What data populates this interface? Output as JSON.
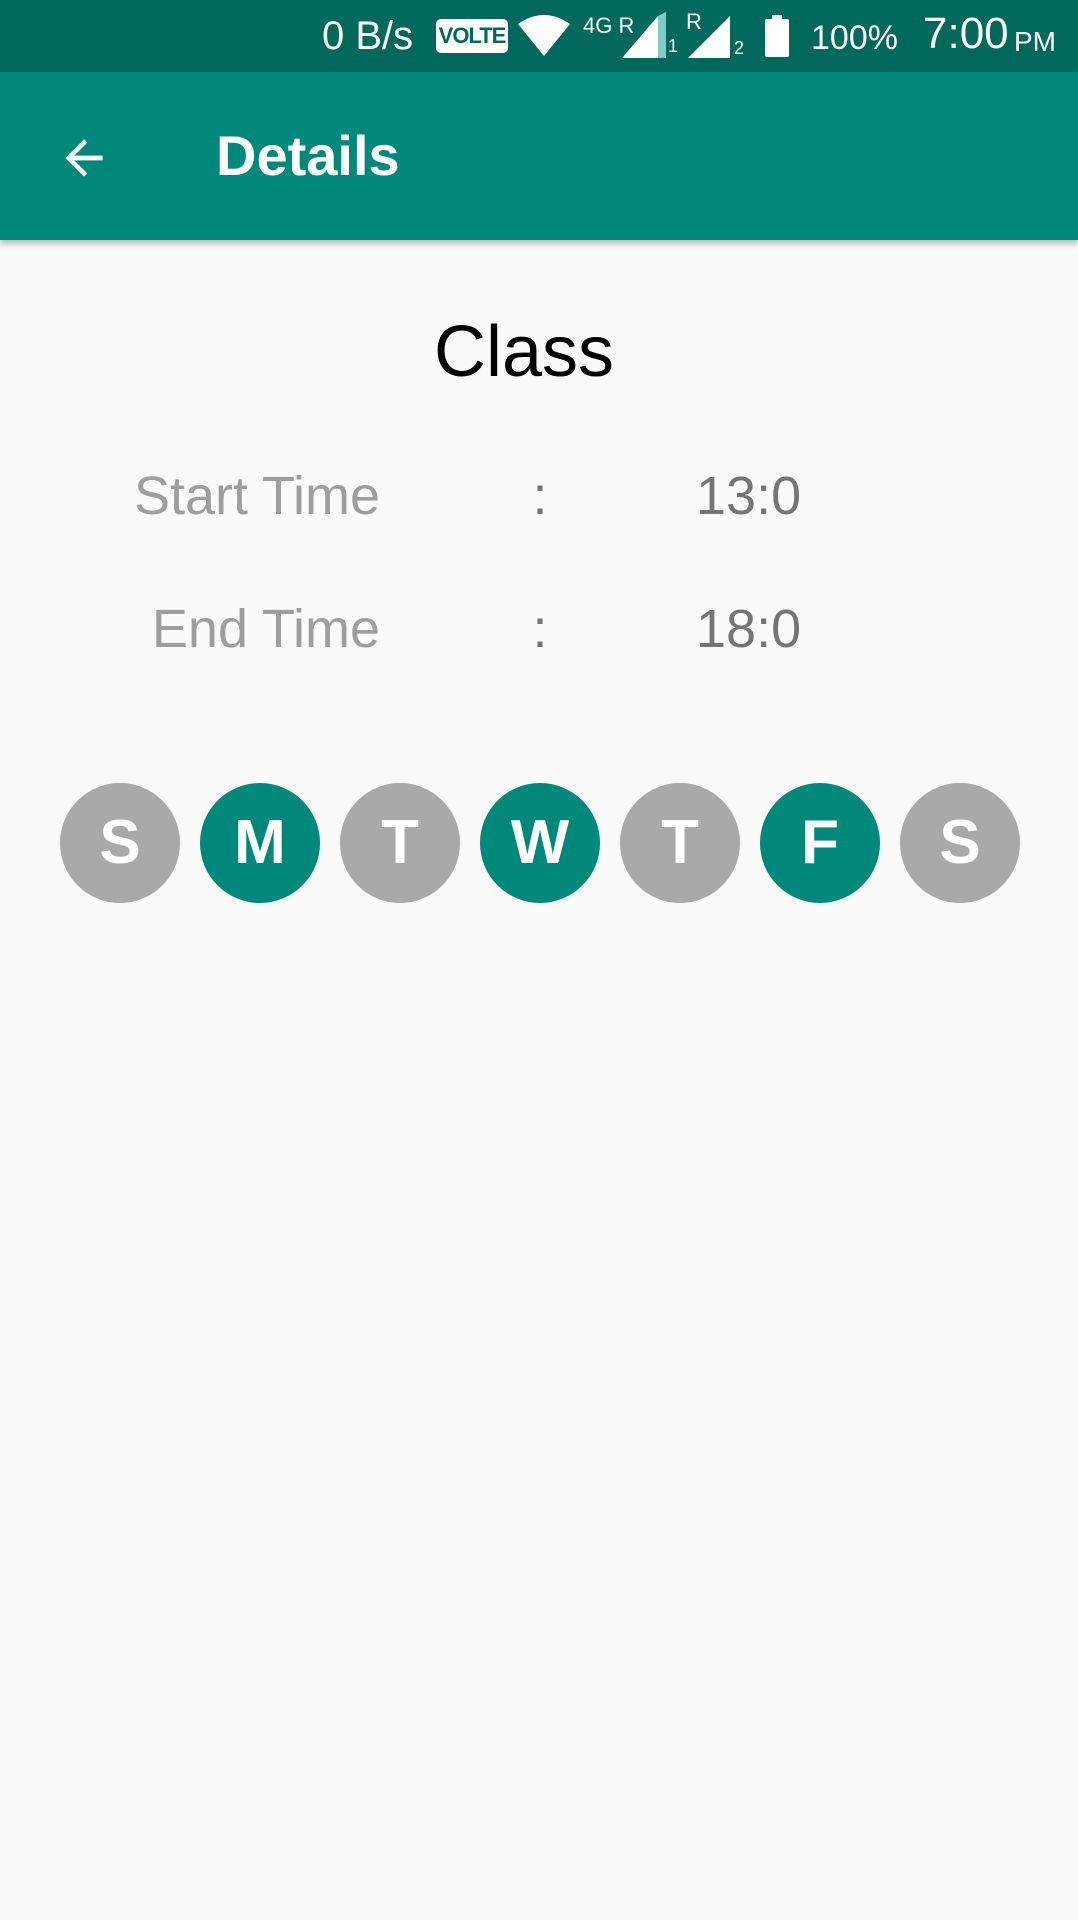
{
  "status_bar": {
    "speed": "0 B/s",
    "volte": "VOLTE",
    "network": "4G R",
    "roaming_1": "R",
    "sim_1": "1",
    "sim_2": "2",
    "battery": "100%",
    "time": "7:00",
    "ampm": "PM"
  },
  "toolbar": {
    "title": "Details",
    "back_icon": "arrow-back-icon"
  },
  "details": {
    "name": "Class",
    "start_label": "Start Time",
    "start_colon": ":",
    "start_value": "13:0",
    "end_label": "End Time",
    "end_colon": ":",
    "end_value": "18:0"
  },
  "days": [
    {
      "letter": "S",
      "selected": false
    },
    {
      "letter": "M",
      "selected": true
    },
    {
      "letter": "T",
      "selected": false
    },
    {
      "letter": "W",
      "selected": true
    },
    {
      "letter": "T",
      "selected": false
    },
    {
      "letter": "F",
      "selected": true
    },
    {
      "letter": "S",
      "selected": false
    }
  ],
  "colors": {
    "status_bar": "#00695c",
    "app_bar": "#00897b",
    "day_selected": "#00897b",
    "day_unselected": "#a9a9a9",
    "background": "#fafafa"
  }
}
